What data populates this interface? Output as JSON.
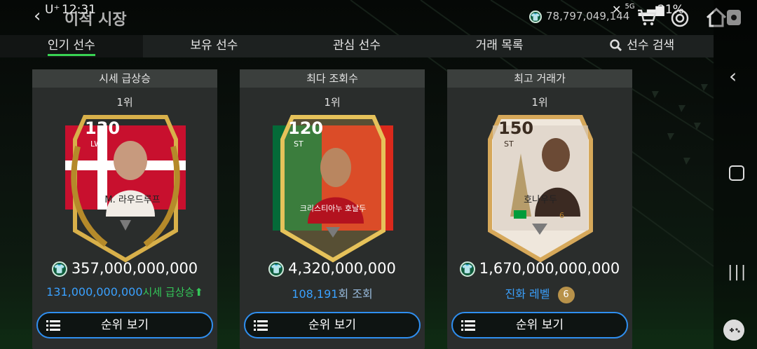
{
  "status": {
    "carrier": "U⁺",
    "time": "12:31",
    "battery": "21%",
    "network": "5G"
  },
  "header": {
    "title": "이적 시장",
    "balance": "78,797,049,144"
  },
  "tabs": [
    {
      "label": "인기 선수",
      "active": true
    },
    {
      "label": "보유 선수",
      "active": false
    },
    {
      "label": "관심 선수",
      "active": false
    },
    {
      "label": "거래 목록",
      "active": false
    },
    {
      "label": "선수 검색",
      "active": false
    }
  ],
  "cards": [
    {
      "heading": "시세 급상승",
      "rank": "1위",
      "player": {
        "ovr": "130",
        "position": "LW",
        "name": "M. 라우드루프",
        "flag": "Denmark"
      },
      "price": "357,000,000,000",
      "sub_value": "131,000,000,000",
      "sub_label": "시세 급상승",
      "sub_icon": "arrow-up-icon",
      "button": "순위 보기"
    },
    {
      "heading": "최다 조회수",
      "rank": "1위",
      "player": {
        "ovr": "120",
        "position": "ST",
        "name": "크리스티아누 호날두",
        "flag": "Portugal"
      },
      "price": "4,320,000,000",
      "sub_value": "108,191",
      "sub_label": "회 조회",
      "button": "순위 보기"
    },
    {
      "heading": "최고 거래가",
      "rank": "1위",
      "player": {
        "ovr": "150",
        "position": "ST",
        "name": "호나우두",
        "flag": "Brazil",
        "level": "6"
      },
      "price": "1,670,000,000,000",
      "sub_value": "진화 레벨",
      "sub_badge": "6",
      "button": "순위 보기"
    }
  ],
  "colors": {
    "accent_green": "#39d353",
    "button_border": "#2f8ff0",
    "value_blue": "#3aa1ff"
  }
}
